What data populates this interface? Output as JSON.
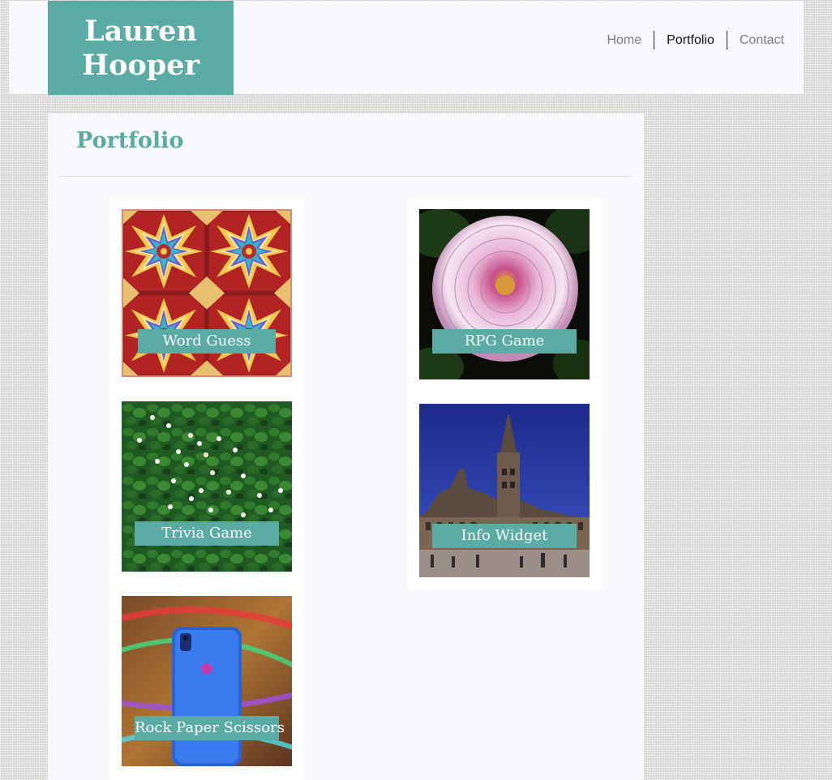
{
  "header": {
    "brand_line1": "Lauren",
    "brand_line2": "Hooper",
    "nav": [
      {
        "label": "Home",
        "active": false
      },
      {
        "label": "Portfolio",
        "active": true
      },
      {
        "label": "Contact",
        "active": false
      }
    ]
  },
  "main": {
    "title": "Portfolio",
    "projects": [
      {
        "label": "Word Guess",
        "image": "kaleidoscope-tiles"
      },
      {
        "label": "RPG Game",
        "image": "dahlia-flower"
      },
      {
        "label": "Trivia Game",
        "image": "daisy-lawn"
      },
      {
        "label": "Info Widget",
        "image": "city-hall-tower"
      },
      {
        "label": "Rock Paper Scissors",
        "image": "blue-phone"
      }
    ]
  },
  "colors": {
    "accent": "#59aba4",
    "panel": "#f8f9fd",
    "background": "#e7e6e3"
  }
}
